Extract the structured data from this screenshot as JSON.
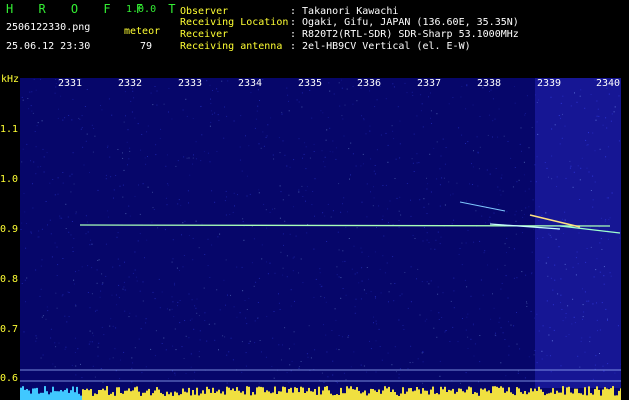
{
  "header": {
    "app_name": "H R O F F T",
    "version": "1.0.0",
    "filename": "2506122330.png",
    "meteor_label": "meteor",
    "meteor_count": "79",
    "datetime": "25.06.12 23:30",
    "observer_label": "Observer",
    "observer_value": ": Takanori Kawachi",
    "location_label": "Receiving Location",
    "location_value": ": Ogaki, Gifu, JAPAN (136.60E, 35.35N)",
    "receiver_label": "Receiver",
    "receiver_value": ": R820T2(RTL-SDR) SDR-Sharp 53.1000MHz",
    "antenna_label": "Receiving antenna",
    "antenna_value": ": 2el-HB9CV Vertical (el. E-W)"
  },
  "axes": {
    "y_unit": "kHz",
    "y_ticks": [
      "1.1",
      "1.0",
      "0.9",
      "0.8",
      "0.7",
      "0.6"
    ],
    "x_ticks": [
      "2331",
      "2332",
      "2333",
      "2334",
      "2335",
      "2336",
      "2337",
      "2338",
      "2339",
      "2340"
    ]
  },
  "colors": {
    "background": "#000000",
    "spectrogram": "#0a0a8c",
    "signal": "#a8ffb8",
    "label": "#ffff33",
    "logo": "#33ee33"
  }
}
